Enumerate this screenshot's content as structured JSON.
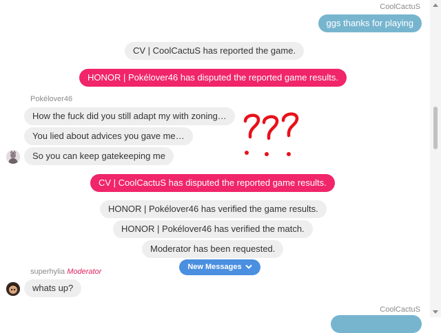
{
  "messages": {
    "self_top": {
      "sender": "CoolCactuS",
      "text": "ggs thanks for playing"
    },
    "sys_report": "CV | CoolCactuS has reported the game.",
    "dispute_honor": "HONOR | Pokélover46 has disputed the reported game results.",
    "pokelover": {
      "sender": "Pokélover46",
      "lines": [
        "How the fuck did you still adapt my with zoning…",
        "You lied about advices you gave me…",
        "So you can keep gatekeeping me"
      ]
    },
    "annotation": "???",
    "dispute_cv": "CV | CoolCactuS has disputed the reported game results.",
    "sys_verified_results": "HONOR | Pokélover46 has verified the game results.",
    "sys_verified_match": "HONOR | Pokélover46 has verified the match.",
    "sys_moderator": "Moderator has been requested.",
    "superhylia": {
      "sender": "superhylia",
      "role": "Moderator",
      "text": "whats up?"
    },
    "self_bottom": {
      "sender": "CoolCactuS"
    }
  },
  "new_messages_button": {
    "label": "New Messages",
    "icon": "chevron-down-icon"
  },
  "colors": {
    "dispute": "#f0256a",
    "self_bubble": "#77b5cf",
    "system_bubble": "#eeeeee",
    "new_messages": "#4a8fe0",
    "annotation": "#e8101a",
    "moderator": "#e0245e"
  }
}
